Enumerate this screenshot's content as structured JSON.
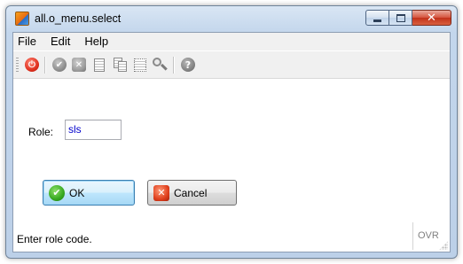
{
  "window": {
    "title": "all.o_menu.select",
    "close_glyph": "✕"
  },
  "menubar": {
    "items": [
      {
        "label": "File"
      },
      {
        "label": "Edit"
      },
      {
        "label": "Help"
      }
    ]
  },
  "toolbar": {
    "buttons": [
      {
        "icon": "power-icon",
        "glyph": "⏻",
        "color": "#e0301e"
      },
      {
        "icon": "check-icon",
        "glyph": "✔",
        "color": "#8a8a8a"
      },
      {
        "icon": "cancel-icon",
        "glyph": "✕",
        "color": "#9a9a9a"
      },
      {
        "icon": "document-icon"
      },
      {
        "icon": "copy-document-icon"
      },
      {
        "icon": "dotted-document-icon"
      },
      {
        "icon": "search-icon"
      },
      {
        "icon": "help-icon",
        "glyph": "?"
      }
    ]
  },
  "form": {
    "role_label": "Role:",
    "role_value": "sls"
  },
  "buttons": {
    "ok_label": "OK",
    "ok_glyph": "✔",
    "cancel_label": "Cancel",
    "cancel_glyph": "✕"
  },
  "status": {
    "message": "Enter role code.",
    "mode": "OVR"
  },
  "colors": {
    "accent": "#3c7fb1",
    "input_text": "#0000cc",
    "close_button": "#c1311a"
  }
}
